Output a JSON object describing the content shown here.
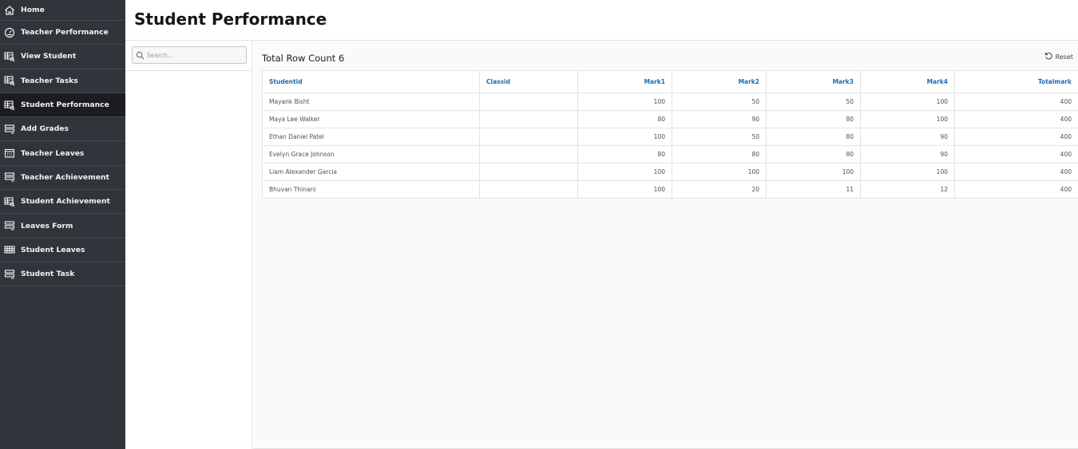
{
  "sidebar": {
    "items": [
      {
        "label": "Home",
        "icon": "home-icon"
      },
      {
        "label": "Teacher Performance",
        "icon": "gauge-icon"
      },
      {
        "label": "View Student",
        "icon": "table-search-icon"
      },
      {
        "label": "Teacher Tasks",
        "icon": "table-search-icon"
      },
      {
        "label": "Student Performance",
        "icon": "table-search-icon",
        "active": true
      },
      {
        "label": "Add Grades",
        "icon": "form-icon"
      },
      {
        "label": "Teacher Leaves",
        "icon": "calendar-icon"
      },
      {
        "label": "Teacher Achievement",
        "icon": "form-icon"
      },
      {
        "label": "Student Achievement",
        "icon": "table-search-icon"
      },
      {
        "label": "Leaves Form",
        "icon": "form-icon"
      },
      {
        "label": "Student Leaves",
        "icon": "grid-icon"
      },
      {
        "label": "Student Task",
        "icon": "form-icon"
      }
    ]
  },
  "page": {
    "title": "Student Performance"
  },
  "search": {
    "placeholder": "Search...",
    "value": ""
  },
  "report": {
    "row_count_label": "Total Row Count 6",
    "reset_label": "Reset",
    "columns": [
      "Studentid",
      "Classid",
      "Mark1",
      "Mark2",
      "Mark3",
      "Mark4",
      "Totalmark"
    ],
    "rows": [
      [
        "Mayank Bisht",
        "",
        "100",
        "50",
        "50",
        "100",
        "400"
      ],
      [
        "Maya Lee Walker",
        "",
        "80",
        "90",
        "80",
        "100",
        "400"
      ],
      [
        "Ethan Daniel Patel",
        "",
        "100",
        "50",
        "80",
        "90",
        "400"
      ],
      [
        "Evelyn Grace Johnson",
        "",
        "80",
        "80",
        "80",
        "90",
        "400"
      ],
      [
        "Liam Alexander Garcia",
        "",
        "100",
        "100",
        "100",
        "100",
        "400"
      ],
      [
        "Bhuvan Thinani",
        "",
        "100",
        "20",
        "11",
        "12",
        "400"
      ]
    ]
  },
  "colors": {
    "sidebar_bg": "#31353b",
    "sidebar_active": "#1b1d20",
    "header_link": "#1e6bb0"
  }
}
